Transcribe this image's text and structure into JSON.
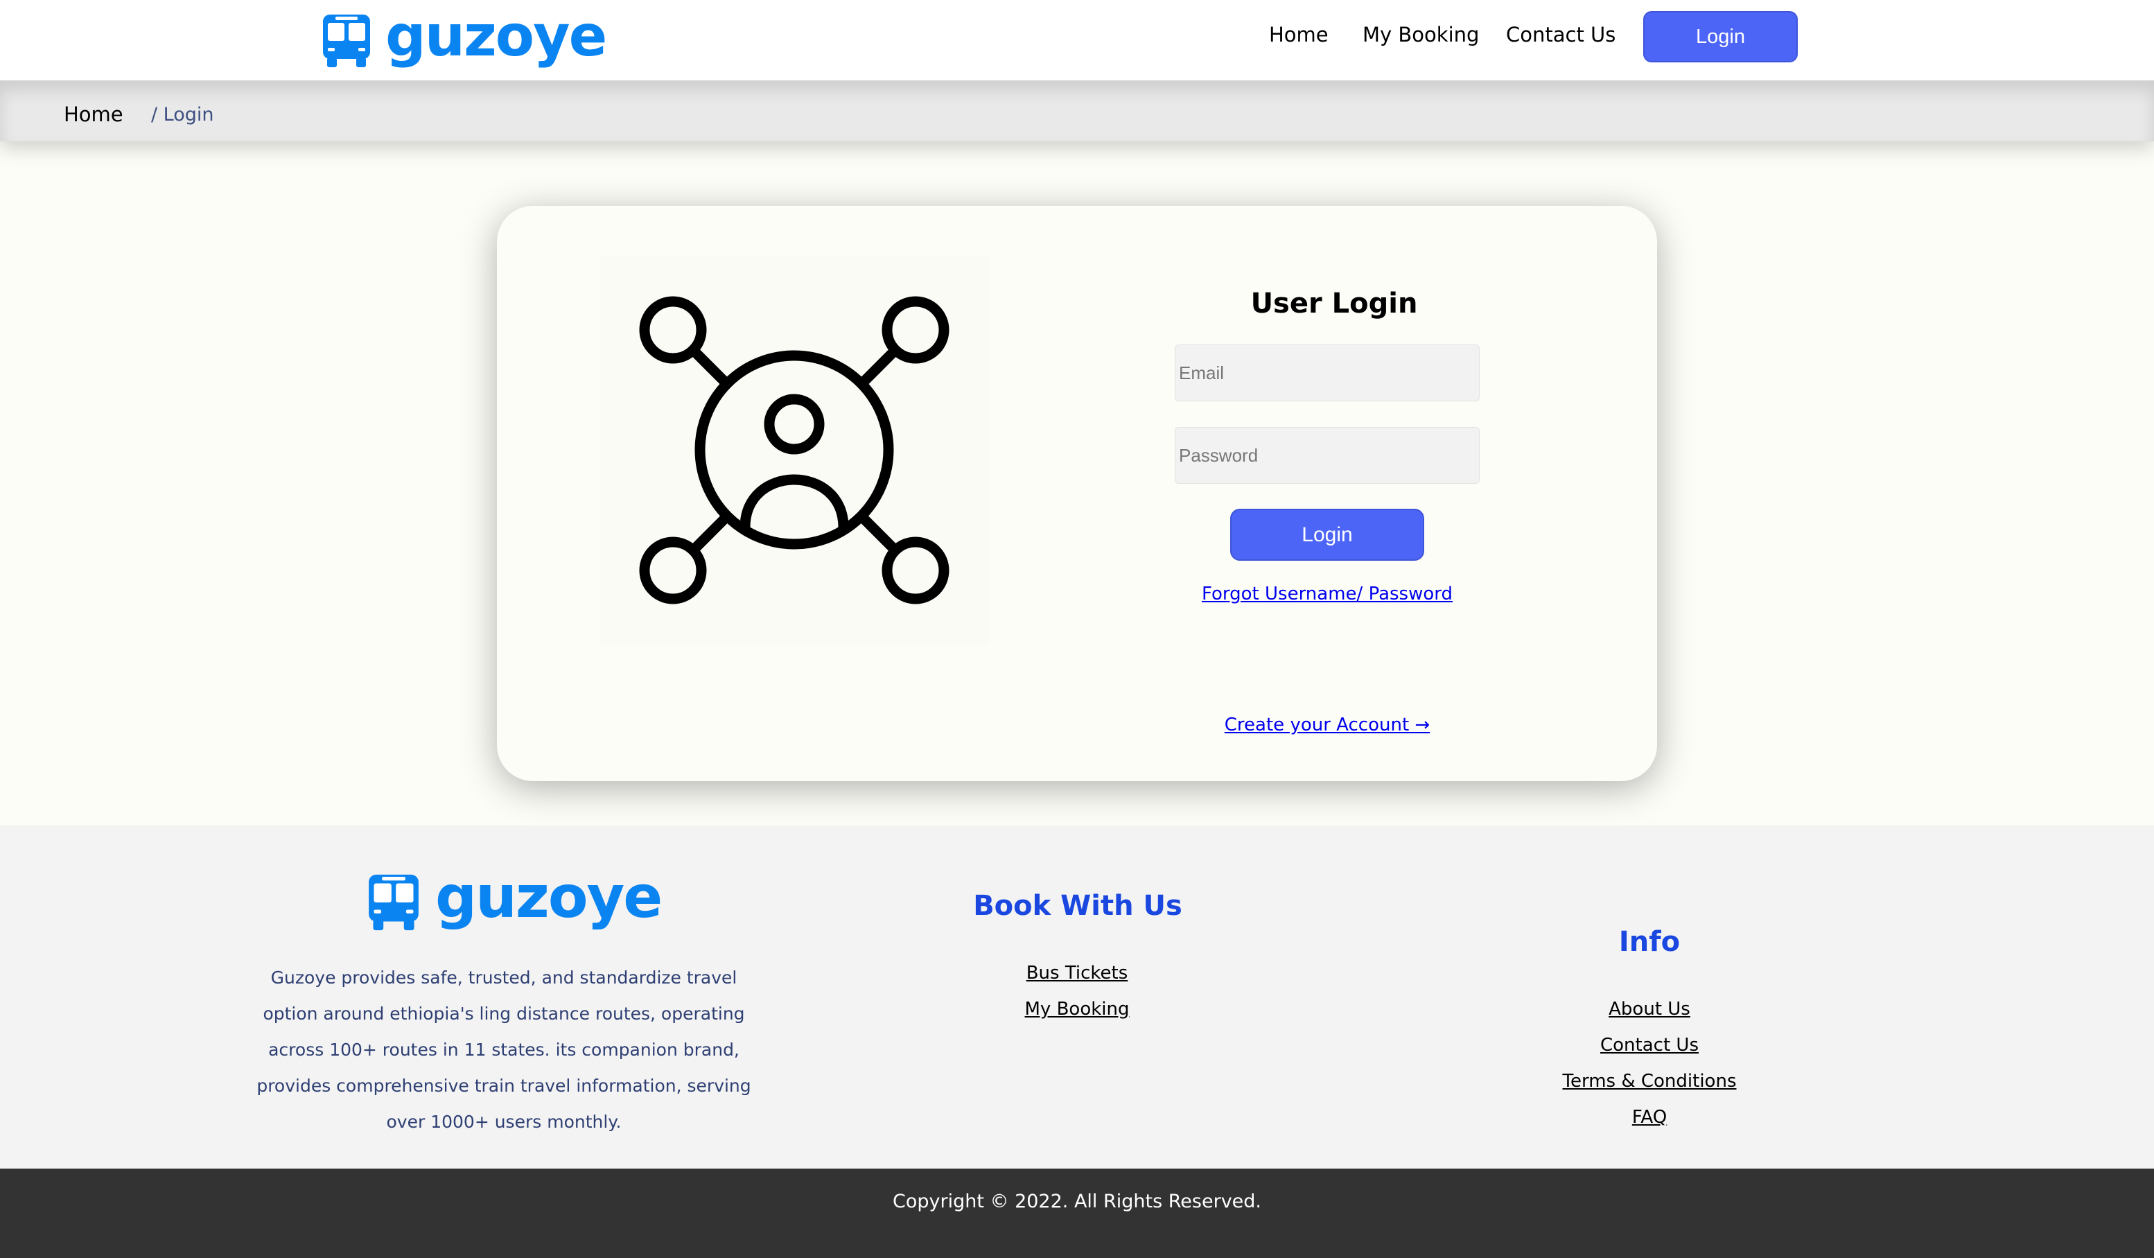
{
  "brand": {
    "name": "guzoye",
    "icon": "bus-icon",
    "color": "#0a84f1"
  },
  "nav": {
    "home": "Home",
    "my_booking": "My Booking",
    "contact": "Contact Us",
    "login": "Login"
  },
  "breadcrumb": {
    "home": "Home",
    "current": "/ Login"
  },
  "login_form": {
    "title": "User Login",
    "email_placeholder": "Email",
    "password_placeholder": "Password",
    "submit": "Login",
    "forgot": "Forgot Username/ Password",
    "create_account": "Create your Account →",
    "illustration_icon": "user-network-icon"
  },
  "footer": {
    "brand": "guzoye",
    "description": "Guzoye provides safe, trusted, and standardize travel option around ethiopia's ling distance routes, operating across 100+ routes in 11 states. its companion brand, provides comprehensive train travel information, serving over 1000+ users monthly.",
    "book_heading": "Book With Us",
    "book_links": [
      "Bus Tickets",
      "My Booking"
    ],
    "info_heading": "Info",
    "info_links": [
      "About Us",
      "Contact Us",
      "Terms & Conditions",
      "FAQ"
    ]
  },
  "copyright": "Copyright © 2022. All Rights Reserved.",
  "colors": {
    "accent": "#4c65f6",
    "heading_blue": "#1a47e0",
    "footer_dark": "#333333"
  }
}
